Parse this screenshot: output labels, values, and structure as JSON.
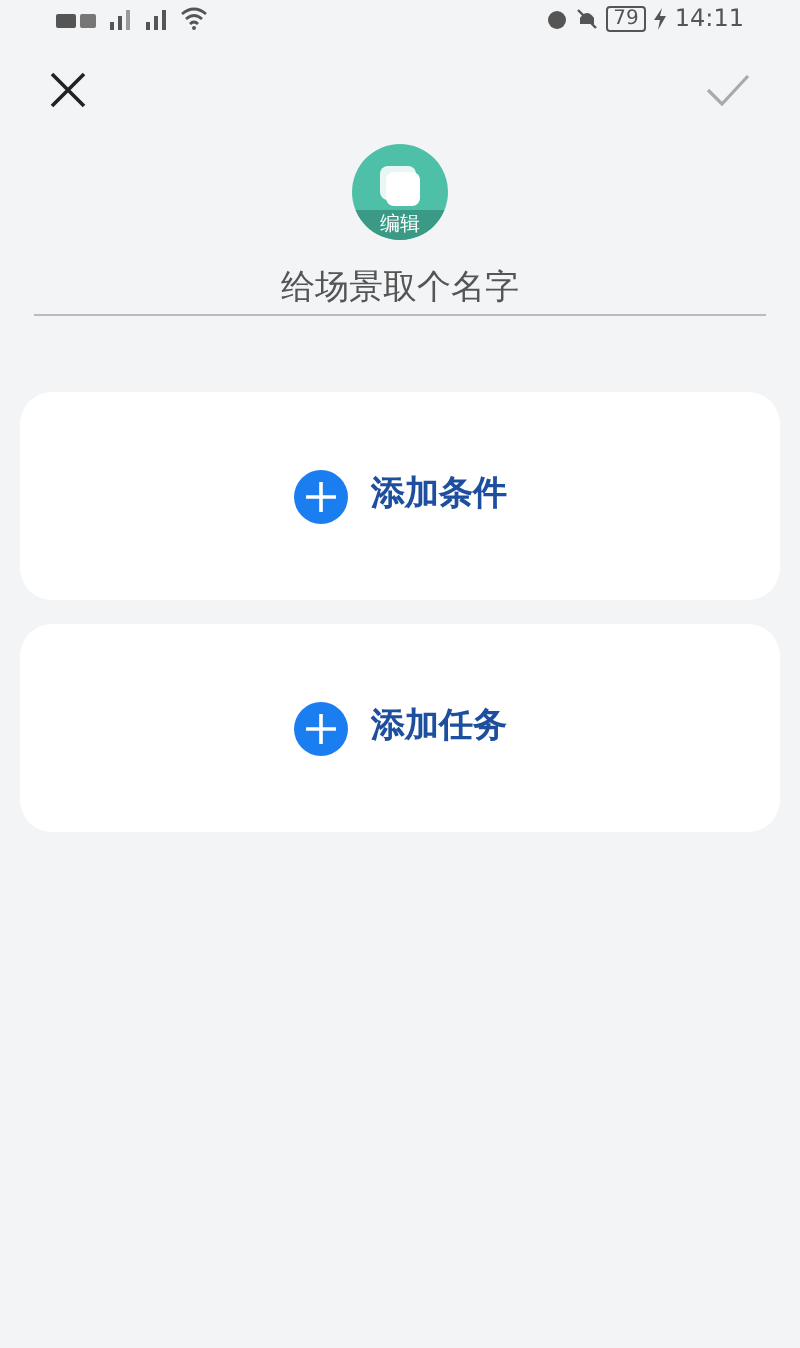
{
  "status_bar": {
    "battery": "79",
    "time": "14:11"
  },
  "scene_icon": {
    "label": "编辑"
  },
  "name_field": {
    "placeholder": "给场景取个名字"
  },
  "cards": [
    {
      "label": "添加条件"
    },
    {
      "label": "添加任务"
    }
  ]
}
